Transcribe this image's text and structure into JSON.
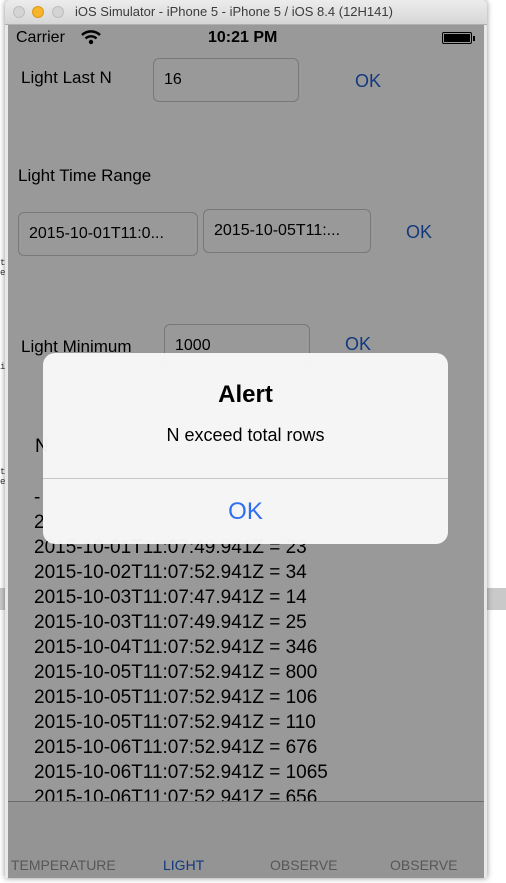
{
  "window": {
    "title": "iOS Simulator - iPhone 5 - iPhone 5 / iOS 8.4 (12H141)"
  },
  "status_bar": {
    "carrier": "Carrier",
    "time": "10:21 PM"
  },
  "light_last_n": {
    "label": "Light Last N",
    "value": "16",
    "ok": "OK"
  },
  "light_time_range": {
    "label": "Light Time Range",
    "start": "2015-10-01T11:0...",
    "end": "2015-10-05T11:...",
    "ok": "OK"
  },
  "light_minimum": {
    "label": "Light Minimum",
    "value": "1000",
    "ok": "OK"
  },
  "results": {
    "heading_fragment": "N",
    "rows": [
      "-",
      "2",
      "2015-10-01T11:07:49.941Z = 23",
      "2015-10-02T11:07:52.941Z = 34",
      "2015-10-03T11:07:47.941Z = 14",
      "2015-10-03T11:07:49.941Z = 25",
      "2015-10-04T11:07:52.941Z = 346",
      "2015-10-05T11:07:52.941Z = 800",
      "2015-10-05T11:07:52.941Z = 106",
      "2015-10-05T11:07:52.941Z = 110",
      "2015-10-06T11:07:52.941Z = 676",
      "2015-10-06T11:07:52.941Z = 1065",
      "2015-10-06T11:07:52.941Z = 656"
    ]
  },
  "tab_bar": {
    "tabs": [
      {
        "label": "TEMPERATURE",
        "active": false
      },
      {
        "label": "LIGHT",
        "active": true
      },
      {
        "label": "OBSERVE",
        "active": false
      },
      {
        "label": "OBSERVE",
        "active": false
      }
    ]
  },
  "alert": {
    "title": "Alert",
    "message": "N exceed total rows",
    "button": "OK"
  },
  "colors": {
    "accent": "#1f5fd1",
    "alert_button": "#2f6ef0",
    "dim_overlay": "rgba(0,0,0,0.40)"
  }
}
